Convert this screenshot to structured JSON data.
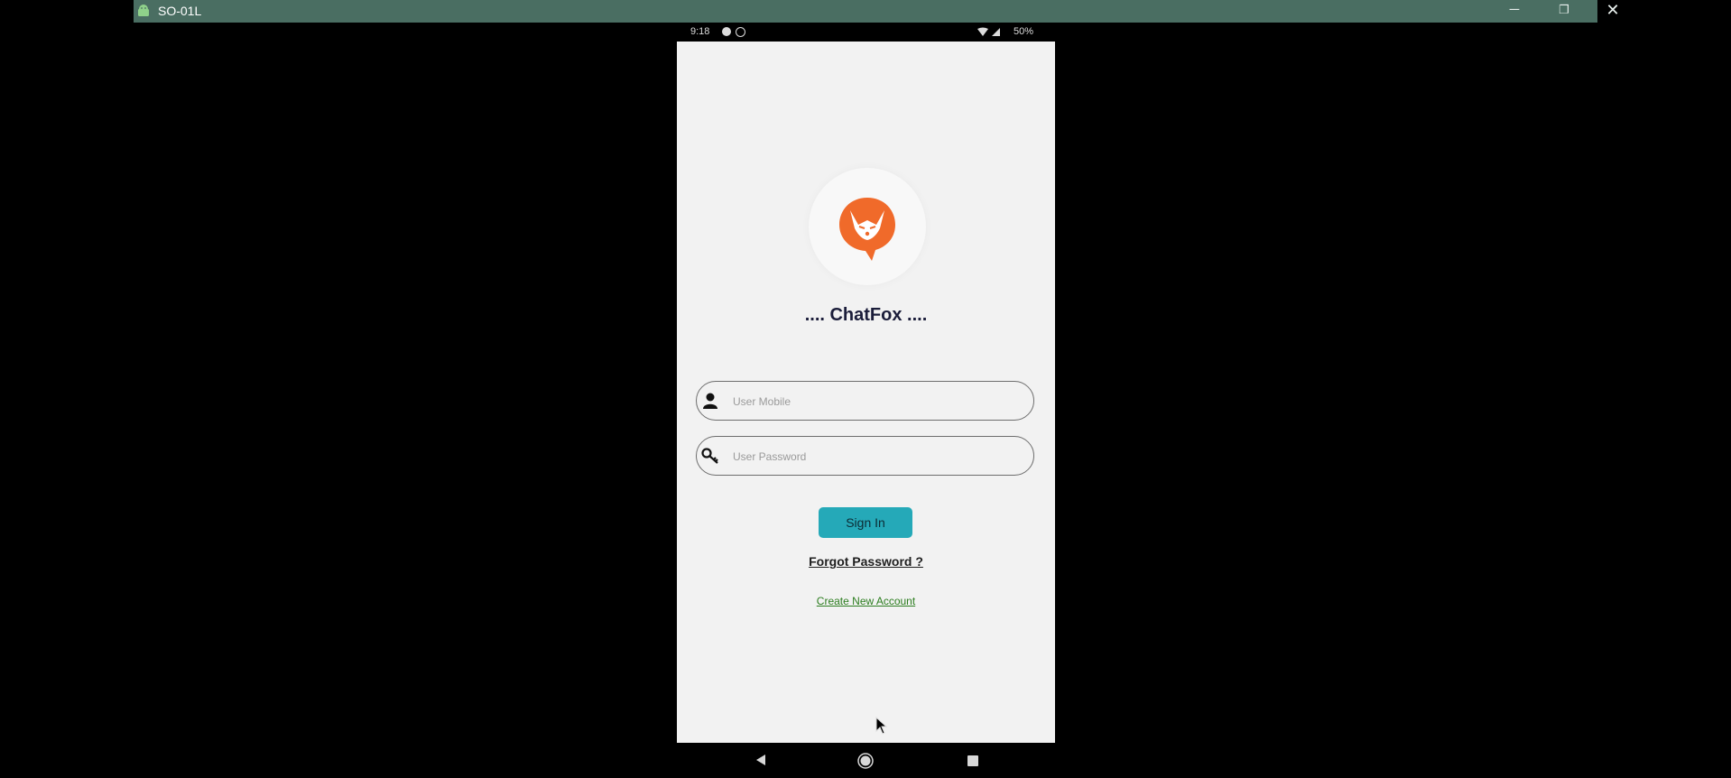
{
  "host_window": {
    "title": "SO-01L",
    "minimize_icon": "─",
    "restore_icon": "❐",
    "close_icon": "✕",
    "bar_color": "#4a6e62"
  },
  "status_bar": {
    "time": "9:18",
    "battery": "50%"
  },
  "app": {
    "title": ".... ChatFox ....",
    "mobile_placeholder": "User Mobile",
    "password_placeholder": "User Password",
    "sign_in_label": "Sign In",
    "forgot_password_label": "Forgot Password ?",
    "create_account_label": "Create New Account",
    "accent_color": "#25a9b8",
    "logo_color": "#f06a2a",
    "link_color": "#2c7d1f"
  },
  "nav_bar": {
    "back_icon": "back-icon",
    "home_icon": "home-icon",
    "recent_icon": "recent-apps-icon"
  }
}
